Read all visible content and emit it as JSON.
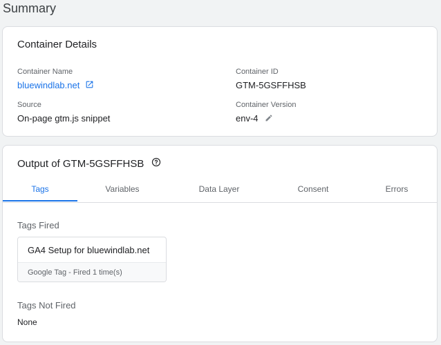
{
  "page": {
    "title": "Summary"
  },
  "container_details": {
    "title": "Container Details",
    "name_label": "Container Name",
    "name_value": "bluewindlab.net",
    "id_label": "Container ID",
    "id_value": "GTM-5GSFFHSB",
    "source_label": "Source",
    "source_value": "On-page gtm.js snippet",
    "version_label": "Container Version",
    "version_value": "env-4",
    "icons": {
      "external_link": "open-in-new-icon",
      "edit": "pencil-icon"
    }
  },
  "output": {
    "title": "Output of GTM-5GSFFHSB",
    "help_icon": "help-circle-icon",
    "tabs": [
      {
        "label": "Tags",
        "active": true
      },
      {
        "label": "Variables",
        "active": false
      },
      {
        "label": "Data Layer",
        "active": false
      },
      {
        "label": "Consent",
        "active": false
      },
      {
        "label": "Errors",
        "active": false
      }
    ],
    "tags_fired_label": "Tags Fired",
    "fired_tags": [
      {
        "name": "GA4 Setup for bluewindlab.net",
        "meta": "Google Tag - Fired 1 time(s)"
      }
    ],
    "tags_not_fired_label": "Tags Not Fired",
    "not_fired_value": "None"
  },
  "colors": {
    "accent": "#1a73e8",
    "background": "#f1f3f4",
    "text": "#202124",
    "muted": "#5f6368"
  }
}
